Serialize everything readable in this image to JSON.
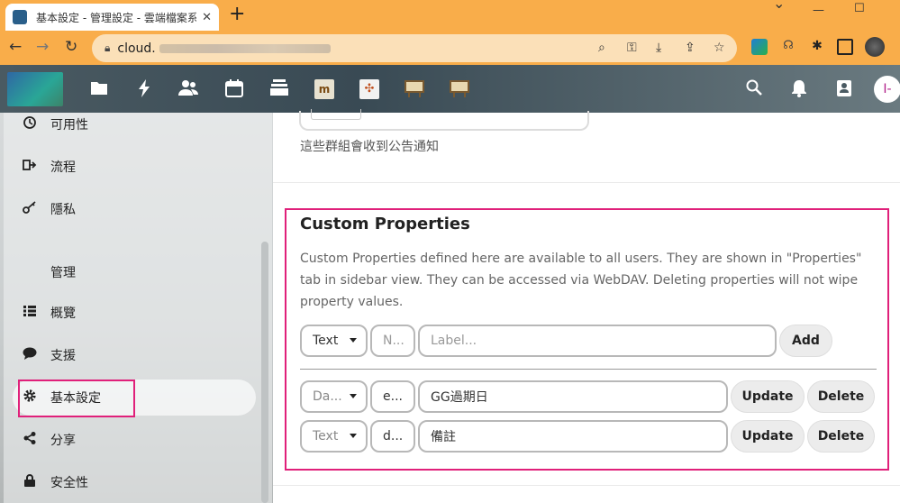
{
  "browser": {
    "tab_title": "基本設定 - 管理設定 - 雲端檔案系",
    "tab_close": "✕",
    "new_tab": "+",
    "url_host": "cloud.",
    "window_controls": {
      "minimize": "—",
      "maximize": "☐",
      "close": "✕"
    }
  },
  "sidebar": {
    "items_top": [
      {
        "label": "可用性",
        "icon": "clock-icon"
      },
      {
        "label": "流程",
        "icon": "flow-icon"
      },
      {
        "label": "隱私",
        "icon": "key-icon"
      }
    ],
    "admin_heading": "管理",
    "items_admin": [
      {
        "label": "概覽",
        "icon": "list-icon"
      },
      {
        "label": "支援",
        "icon": "chat-icon"
      },
      {
        "label": "基本設定",
        "icon": "gear-icon"
      },
      {
        "label": "分享",
        "icon": "share-icon"
      },
      {
        "label": "安全性",
        "icon": "lock-icon"
      }
    ]
  },
  "main": {
    "prev_note": "這些群組會收到公告通知",
    "section_title": "Custom Properties",
    "section_desc": "Custom Properties defined here are available to all users. They are shown in \"Properties\" tab in sidebar view. They can be accessed via WebDAV. Deleting properties will not wipe property values.",
    "new_row": {
      "type": "Text",
      "name_placeholder": "N...",
      "label_placeholder": "Label...",
      "add_label": "Add"
    },
    "properties": [
      {
        "type": "Da...",
        "name": "e...",
        "label": "GG過期日",
        "update_label": "Update",
        "delete_label": "Delete"
      },
      {
        "type": "Text",
        "name": "d...",
        "label": "備註",
        "update_label": "Update",
        "delete_label": "Delete"
      }
    ]
  },
  "header": {
    "avatar_initial": "I-"
  },
  "colors": {
    "highlight": "#e0207a",
    "browser_frame": "#f9ad4a"
  }
}
